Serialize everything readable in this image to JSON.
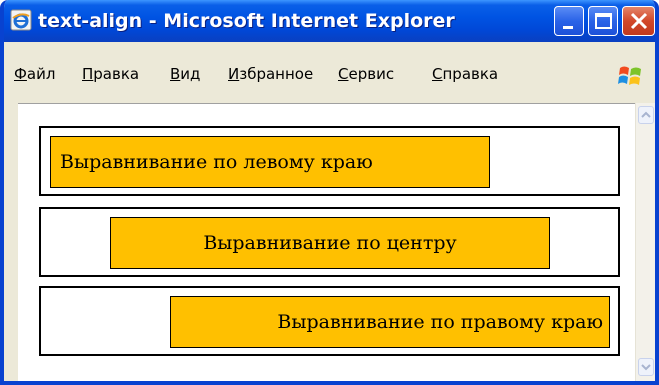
{
  "window": {
    "title": "text-align - Microsoft Internet Explorer"
  },
  "menu": {
    "items": [
      "Файл",
      "Правка",
      "Вид",
      "Избранное",
      "Сервис",
      "Справка"
    ]
  },
  "content": {
    "blocks": [
      {
        "text": "Выравнивание по левому краю",
        "align": "left"
      },
      {
        "text": "Выравнивание по центру",
        "align": "center"
      },
      {
        "text": "Выравнивание по правому краю",
        "align": "right"
      }
    ],
    "colors": {
      "highlight": "#ffc000",
      "border": "#000000",
      "background": "#ffffff"
    }
  }
}
